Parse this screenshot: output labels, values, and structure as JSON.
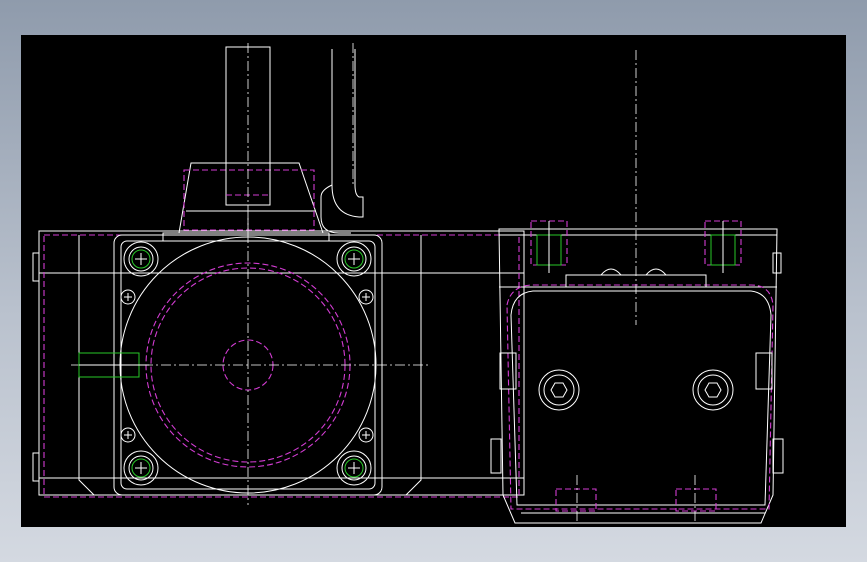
{
  "drawing": {
    "background": "#000000",
    "colors": {
      "outline": "#ffffff",
      "hidden": "#d23cd2",
      "thread": "#28c828"
    },
    "views": [
      {
        "name": "front-view"
      },
      {
        "name": "side-view"
      }
    ]
  }
}
